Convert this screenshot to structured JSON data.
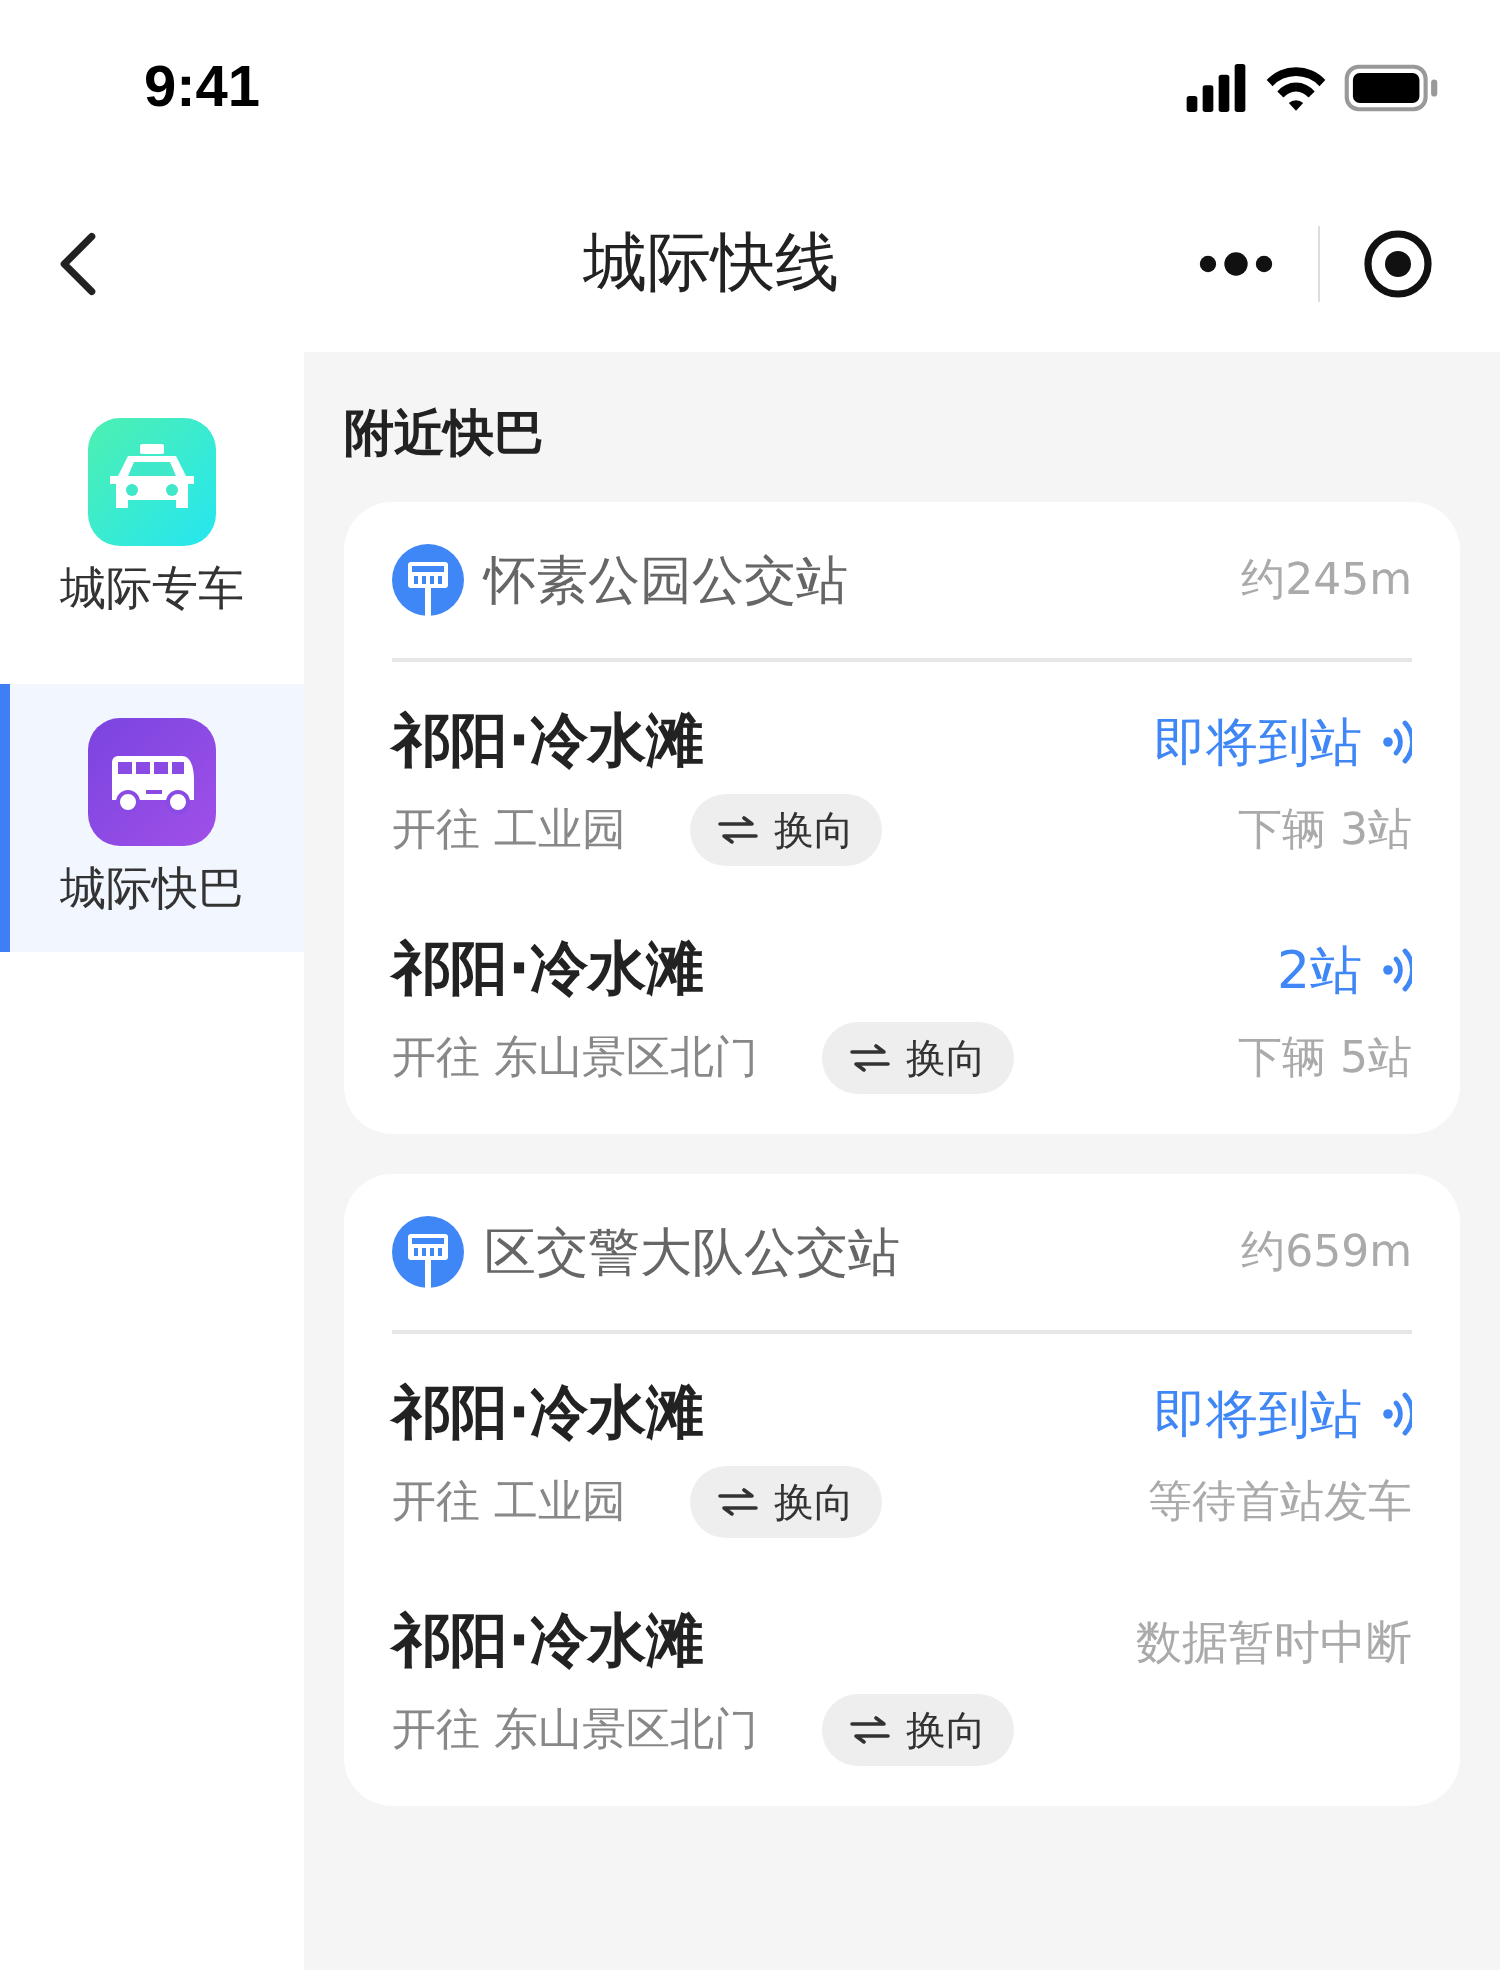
{
  "status_bar": {
    "time": "9:41"
  },
  "nav": {
    "title": "城际快线"
  },
  "sidebar": {
    "items": [
      {
        "label": "城际专车",
        "kind": "car",
        "selected": false
      },
      {
        "label": "城际快巴",
        "kind": "bus",
        "selected": true
      }
    ]
  },
  "section_title": "附近快巴",
  "stations": [
    {
      "name": "怀素公园公交站",
      "distance": "约245m",
      "routes": [
        {
          "name": "祁阳·冷水滩",
          "status": {
            "kind": "live",
            "text": "即将到站"
          },
          "destination": "开往 工业园",
          "swap": "换向",
          "note": "下辆 3站"
        },
        {
          "name": "祁阳·冷水滩",
          "status": {
            "kind": "live",
            "text": "2站"
          },
          "destination": "开往 东山景区北门",
          "swap": "换向",
          "note": "下辆 5站"
        }
      ]
    },
    {
      "name": "区交警大队公交站",
      "distance": "约659m",
      "routes": [
        {
          "name": "祁阳·冷水滩",
          "status": {
            "kind": "live",
            "text": "即将到站"
          },
          "destination": "开往 工业园",
          "swap": "换向",
          "note": "等待首站发车"
        },
        {
          "name": "祁阳·冷水滩",
          "status": {
            "kind": "plain",
            "text": "数据暂时中断"
          },
          "destination": "开往 东山景区北门",
          "swap": "换向"
        }
      ]
    }
  ]
}
